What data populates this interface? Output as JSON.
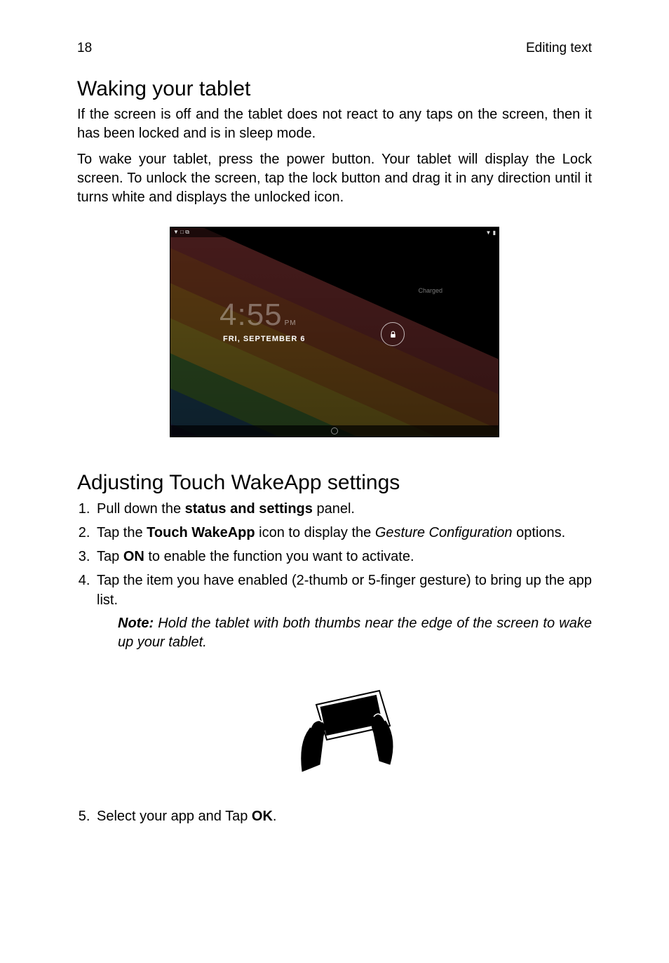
{
  "header": {
    "page_number": "18",
    "section_label": "Editing text"
  },
  "section1": {
    "heading": "Waking your tablet",
    "p1": "If the screen is off and the tablet does not react to any taps on the screen, then it has been locked and is in sleep mode.",
    "p2": "To wake your tablet, press the power button. Your tablet will display the Lock screen. To unlock the screen, tap the lock button and drag it in any direction until it turns white and displays the unlocked icon."
  },
  "lockscreen": {
    "time": "4:55",
    "ampm": "PM",
    "date": "FRI, SEPTEMBER 6",
    "charged_label": "Charged",
    "status_left_icons": "▼ □ ⧉",
    "status_right_icons": "▼ ▮"
  },
  "section2": {
    "heading": "Adjusting Touch WakeApp settings",
    "step1_a": "Pull down the ",
    "step1_b": "status and settings",
    "step1_c": " panel.",
    "step2_a": "Tap the ",
    "step2_b": "Touch WakeApp",
    "step2_c": " icon to display the ",
    "step2_d": "Gesture Configuration",
    "step2_e": " options.",
    "step3_a": "Tap ",
    "step3_b": "ON",
    "step3_c": " to enable the function you want to activate.",
    "step4": "Tap the item you have enabled (2-thumb or 5-finger gesture) to bring up the app list.",
    "note_label": "Note:",
    "note_text": " Hold the tablet with both thumbs near the edge of the screen to wake up your tablet.",
    "step5_a": "Select your app and Tap ",
    "step5_b": "OK",
    "step5_c": "."
  }
}
